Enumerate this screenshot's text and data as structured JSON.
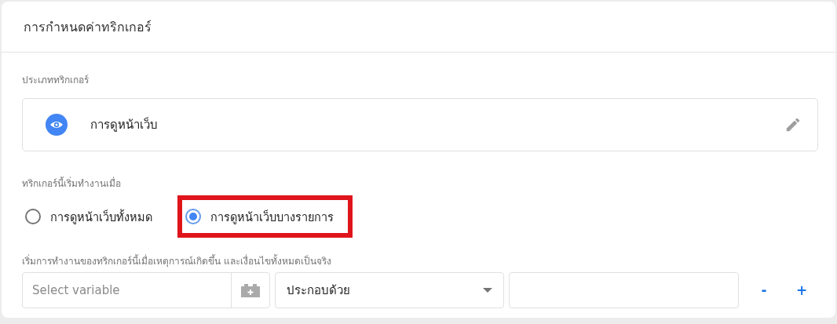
{
  "panel": {
    "title": "การกำหนดค่าทริกเกอร์"
  },
  "trigger_type": {
    "label": "ประเภททริกเกอร์",
    "name": "การดูหน้าเว็บ"
  },
  "fires_on": {
    "label": "ทริกเกอร์นี้เริ่มทำงานเมื่อ",
    "options": [
      {
        "label": "การดูหน้าเว็บทั้งหมด",
        "selected": false,
        "highlighted": false
      },
      {
        "label": "การดูหน้าเว็บบางรายการ",
        "selected": true,
        "highlighted": true
      }
    ]
  },
  "conditions": {
    "label": "เริ่มการทำงานของทริกเกอร์นี้เมื่อเหตุการณ์เกิดขึ้น และเงื่อนไขทั้งหมดเป็นจริง",
    "rows": [
      {
        "variable_placeholder": "Select variable",
        "operator": "ประกอบด้วย",
        "remove": "-",
        "add": "+"
      }
    ]
  }
}
